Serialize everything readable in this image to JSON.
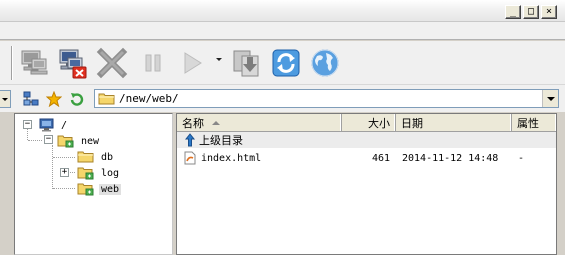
{
  "window": {
    "minimize_glyph": "_",
    "maximize_glyph": "□",
    "close_glyph": "×"
  },
  "toolbar": {
    "buttons": [
      {
        "name": "connect-icon"
      },
      {
        "name": "disconnect-icon"
      },
      {
        "name": "cancel-icon"
      },
      {
        "name": "pause-icon"
      },
      {
        "name": "play-icon"
      },
      {
        "name": "download-icon"
      },
      {
        "name": "refresh-icon"
      },
      {
        "name": "globe-icon"
      }
    ]
  },
  "address": {
    "path": "/new/web/"
  },
  "tree": {
    "root": "/",
    "nodes": [
      {
        "label": "new"
      },
      {
        "label": "db"
      },
      {
        "label": "log"
      },
      {
        "label": "web",
        "selected": true
      }
    ]
  },
  "list": {
    "columns": {
      "name": "名称",
      "size": "大小",
      "date": "日期",
      "attr": "属性"
    },
    "parent_label": "上级目录",
    "rows": [
      {
        "name": "index.html",
        "size": "461",
        "date": "2014-11-12 14:48",
        "attr": "-"
      }
    ]
  },
  "colors": {
    "folder_yellow": "#f5d66b",
    "accent_blue": "#2a78c8",
    "close_red": "#e03020"
  }
}
